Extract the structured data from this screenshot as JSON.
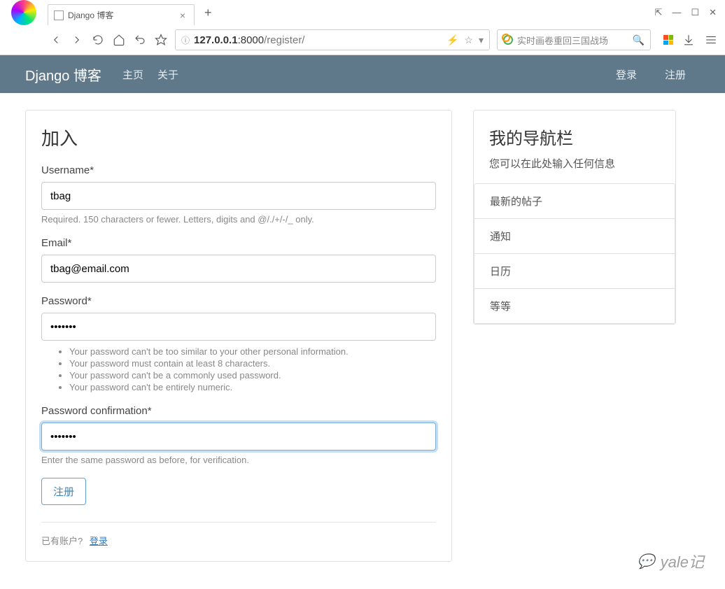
{
  "browser": {
    "tab_title": "Django 博客",
    "url_host": "127.0.0.1",
    "url_port": ":8000",
    "url_path": "/register/",
    "search_placeholder": "实时画卷重回三国战场"
  },
  "navbar": {
    "brand": "Django 博客",
    "links": [
      "主页",
      "关于"
    ],
    "right": [
      "登录",
      "注册"
    ]
  },
  "form": {
    "title": "加入",
    "username_label": "Username*",
    "username_value": "tbag",
    "username_help": "Required. 150 characters or fewer. Letters, digits and @/./+/-/_ only.",
    "email_label": "Email*",
    "email_value": "tbag@email.com",
    "password_label": "Password*",
    "password_value": "•••••••",
    "password_help": [
      "Your password can't be too similar to your other personal information.",
      "Your password must contain at least 8 characters.",
      "Your password can't be a commonly used password.",
      "Your password can't be entirely numeric."
    ],
    "password2_label": "Password confirmation*",
    "password2_value": "•••••••",
    "password2_help": "Enter the same password as before, for verification.",
    "submit_label": "注册",
    "have_account": "已有账户?",
    "login_link": "登录"
  },
  "sidebar": {
    "title": "我的导航栏",
    "subtitle": "您可以在此处输入任何信息",
    "items": [
      "最新的帖子",
      "通知",
      "日历",
      "等等"
    ]
  },
  "watermark": "yale记"
}
